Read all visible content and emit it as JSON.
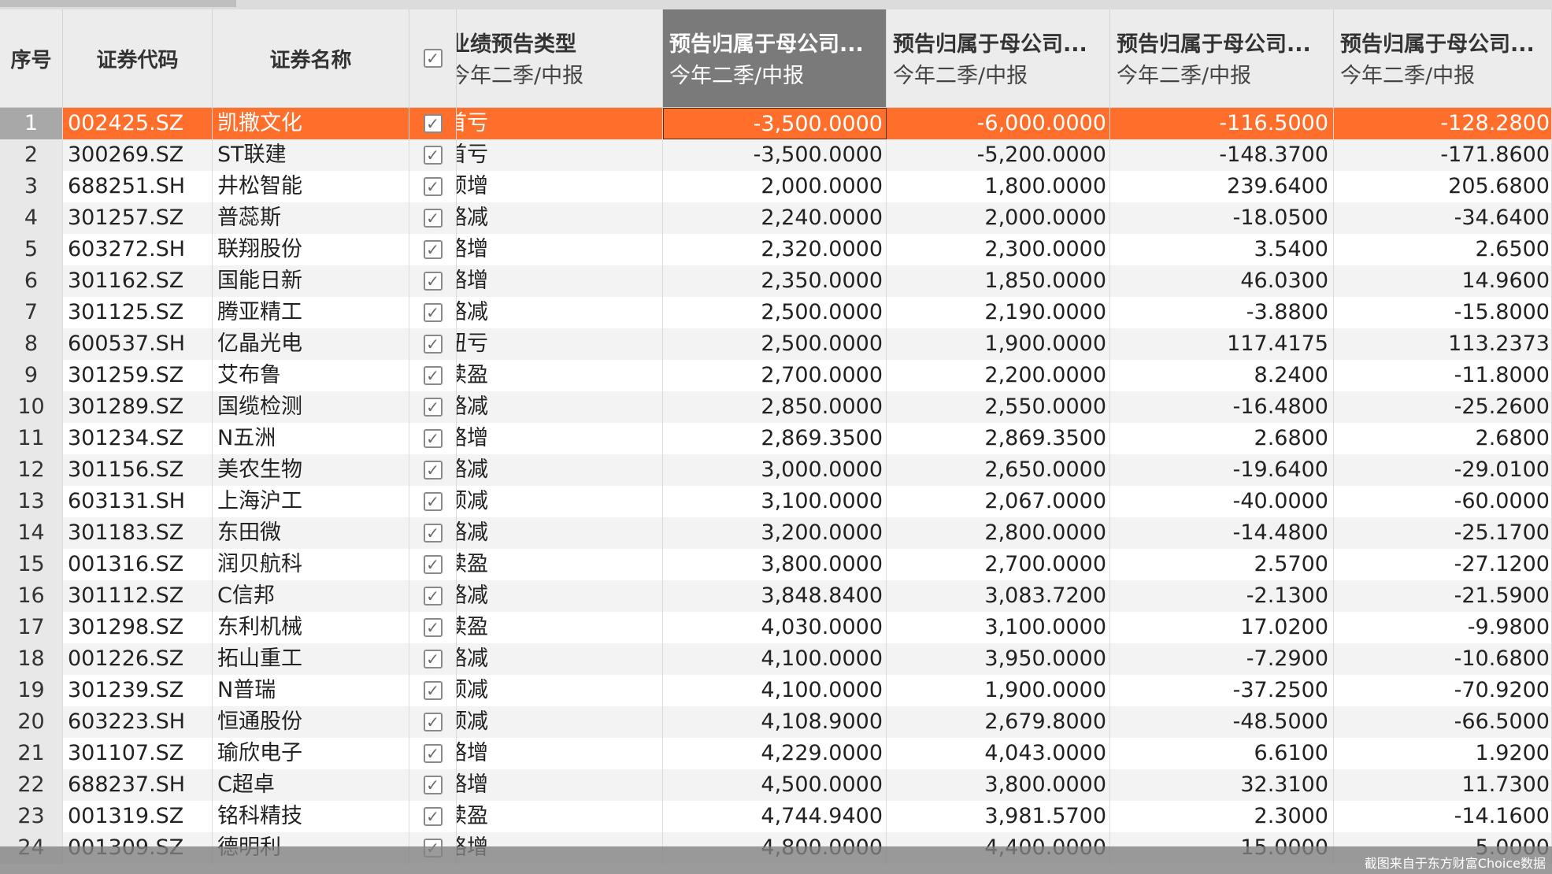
{
  "header": {
    "col_index": "序号",
    "col_code": "证券代码",
    "col_name": "证券名称",
    "col_type": {
      "title": "业绩预告类型",
      "sub": "今年二季/中报"
    },
    "col_a": {
      "title": "预告归属于母公司...",
      "sub": "今年二季/中报"
    },
    "col_b": {
      "title": "预告归属于母公司...",
      "sub": "今年二季/中报"
    },
    "col_c": {
      "title": "预告归属于母公司...",
      "sub": "今年二季/中报"
    },
    "col_d": {
      "title": "预告归属于母公司...",
      "sub": "今年二季/中报"
    }
  },
  "accent_color": "#ff6e2a",
  "selected_row": 1,
  "rows": [
    {
      "idx": "1",
      "code": "002425.SZ",
      "name": "凯撒文化",
      "type": "首亏",
      "a": "-3,500.0000",
      "b": "-6,000.0000",
      "c": "-116.5000",
      "d": "-128.2800"
    },
    {
      "idx": "2",
      "code": "300269.SZ",
      "name": "ST联建",
      "type": "首亏",
      "a": "-3,500.0000",
      "b": "-5,200.0000",
      "c": "-148.3700",
      "d": "-171.8600"
    },
    {
      "idx": "3",
      "code": "688251.SH",
      "name": "井松智能",
      "type": "预增",
      "a": "2,000.0000",
      "b": "1,800.0000",
      "c": "239.6400",
      "d": "205.6800"
    },
    {
      "idx": "4",
      "code": "301257.SZ",
      "name": "普蕊斯",
      "type": "略减",
      "a": "2,240.0000",
      "b": "2,000.0000",
      "c": "-18.0500",
      "d": "-34.6400"
    },
    {
      "idx": "5",
      "code": "603272.SH",
      "name": "联翔股份",
      "type": "略增",
      "a": "2,320.0000",
      "b": "2,300.0000",
      "c": "3.5400",
      "d": "2.6500"
    },
    {
      "idx": "6",
      "code": "301162.SZ",
      "name": "国能日新",
      "type": "略增",
      "a": "2,350.0000",
      "b": "1,850.0000",
      "c": "46.0300",
      "d": "14.9600"
    },
    {
      "idx": "7",
      "code": "301125.SZ",
      "name": "腾亚精工",
      "type": "略减",
      "a": "2,500.0000",
      "b": "2,190.0000",
      "c": "-3.8800",
      "d": "-15.8000"
    },
    {
      "idx": "8",
      "code": "600537.SH",
      "name": "亿晶光电",
      "type": "扭亏",
      "a": "2,500.0000",
      "b": "1,900.0000",
      "c": "117.4175",
      "d": "113.2373"
    },
    {
      "idx": "9",
      "code": "301259.SZ",
      "name": "艾布鲁",
      "type": "续盈",
      "a": "2,700.0000",
      "b": "2,200.0000",
      "c": "8.2400",
      "d": "-11.8000"
    },
    {
      "idx": "10",
      "code": "301289.SZ",
      "name": "国缆检测",
      "type": "略减",
      "a": "2,850.0000",
      "b": "2,550.0000",
      "c": "-16.4800",
      "d": "-25.2600"
    },
    {
      "idx": "11",
      "code": "301234.SZ",
      "name": "N五洲",
      "type": "略增",
      "a": "2,869.3500",
      "b": "2,869.3500",
      "c": "2.6800",
      "d": "2.6800"
    },
    {
      "idx": "12",
      "code": "301156.SZ",
      "name": "美农生物",
      "type": "略减",
      "a": "3,000.0000",
      "b": "2,650.0000",
      "c": "-19.6400",
      "d": "-29.0100"
    },
    {
      "idx": "13",
      "code": "603131.SH",
      "name": "上海沪工",
      "type": "预减",
      "a": "3,100.0000",
      "b": "2,067.0000",
      "c": "-40.0000",
      "d": "-60.0000"
    },
    {
      "idx": "14",
      "code": "301183.SZ",
      "name": "东田微",
      "type": "略减",
      "a": "3,200.0000",
      "b": "2,800.0000",
      "c": "-14.4800",
      "d": "-25.1700"
    },
    {
      "idx": "15",
      "code": "001316.SZ",
      "name": "润贝航科",
      "type": "续盈",
      "a": "3,800.0000",
      "b": "2,700.0000",
      "c": "2.5700",
      "d": "-27.1200"
    },
    {
      "idx": "16",
      "code": "301112.SZ",
      "name": "C信邦",
      "type": "略减",
      "a": "3,848.8400",
      "b": "3,083.7200",
      "c": "-2.1300",
      "d": "-21.5900"
    },
    {
      "idx": "17",
      "code": "301298.SZ",
      "name": "东利机械",
      "type": "续盈",
      "a": "4,030.0000",
      "b": "3,100.0000",
      "c": "17.0200",
      "d": "-9.9800"
    },
    {
      "idx": "18",
      "code": "001226.SZ",
      "name": "拓山重工",
      "type": "略减",
      "a": "4,100.0000",
      "b": "3,950.0000",
      "c": "-7.2900",
      "d": "-10.6800"
    },
    {
      "idx": "19",
      "code": "301239.SZ",
      "name": "N普瑞",
      "type": "预减",
      "a": "4,100.0000",
      "b": "1,900.0000",
      "c": "-37.2500",
      "d": "-70.9200"
    },
    {
      "idx": "20",
      "code": "603223.SH",
      "name": "恒通股份",
      "type": "预减",
      "a": "4,108.9000",
      "b": "2,679.8000",
      "c": "-48.5000",
      "d": "-66.5000"
    },
    {
      "idx": "21",
      "code": "301107.SZ",
      "name": "瑜欣电子",
      "type": "略增",
      "a": "4,229.0000",
      "b": "4,043.0000",
      "c": "6.6100",
      "d": "1.9200"
    },
    {
      "idx": "22",
      "code": "688237.SH",
      "name": "C超卓",
      "type": "略增",
      "a": "4,500.0000",
      "b": "3,800.0000",
      "c": "32.3100",
      "d": "11.7300"
    },
    {
      "idx": "23",
      "code": "001319.SZ",
      "name": "铭科精技",
      "type": "续盈",
      "a": "4,744.9400",
      "b": "3,981.5700",
      "c": "2.3000",
      "d": "-14.1600"
    },
    {
      "idx": "24",
      "code": "001309.SZ",
      "name": "德明利",
      "type": "略增",
      "a": "4,800.0000",
      "b": "4,400.0000",
      "c": "15.0000",
      "d": "5.0000"
    }
  ],
  "watermark": "截图来自于东方财富Choice数据"
}
